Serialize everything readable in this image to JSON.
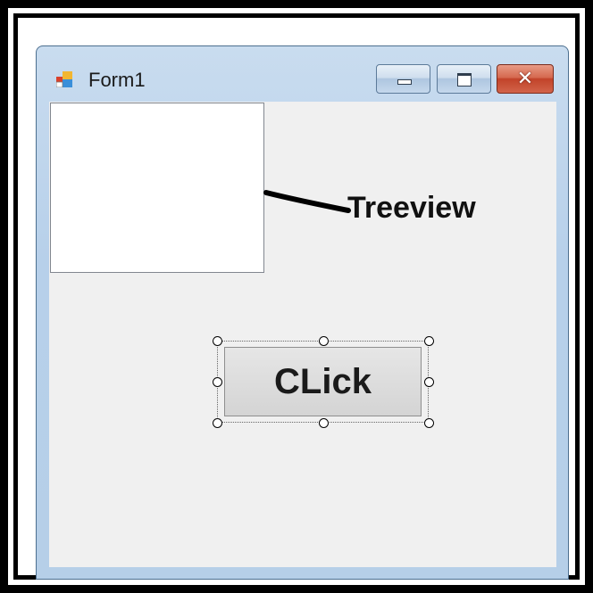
{
  "window": {
    "title": "Form1",
    "icon": "form-app-icon",
    "controls": {
      "minimize_icon": "minimize-icon",
      "maximize_icon": "maximize-icon",
      "close_icon": "close-icon",
      "close_glyph": "✕"
    }
  },
  "form": {
    "treeview_annotation": "Treeview",
    "button_label": "CLick"
  }
}
